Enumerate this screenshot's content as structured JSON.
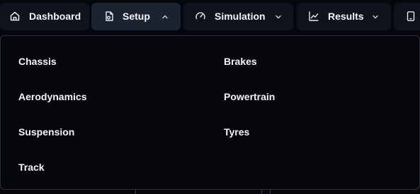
{
  "nav": {
    "tabs": [
      {
        "label": "Dashboard",
        "icon": "home-icon",
        "has_chevron": false
      },
      {
        "label": "Setup",
        "icon": "file-settings-icon",
        "has_chevron": true,
        "chevron": "up"
      },
      {
        "label": "Simulation",
        "icon": "gauge-icon",
        "has_chevron": true,
        "chevron": "down"
      },
      {
        "label": "Results",
        "icon": "line-chart-icon",
        "has_chevron": true,
        "chevron": "down"
      },
      {
        "label": "",
        "icon": "tablet-icon",
        "has_chevron": false
      }
    ]
  },
  "setup_menu": {
    "left_column": [
      "Chassis",
      "Aerodynamics",
      "Suspension",
      "Track"
    ],
    "right_column": [
      "Brakes",
      "Powertrain",
      "Tyres"
    ]
  },
  "colors": {
    "background": "#05070d",
    "tab_bg": "#0e131d",
    "tab_active_bg": "#1b2230",
    "border": "#2a313d",
    "text": "#f3f5f8"
  }
}
